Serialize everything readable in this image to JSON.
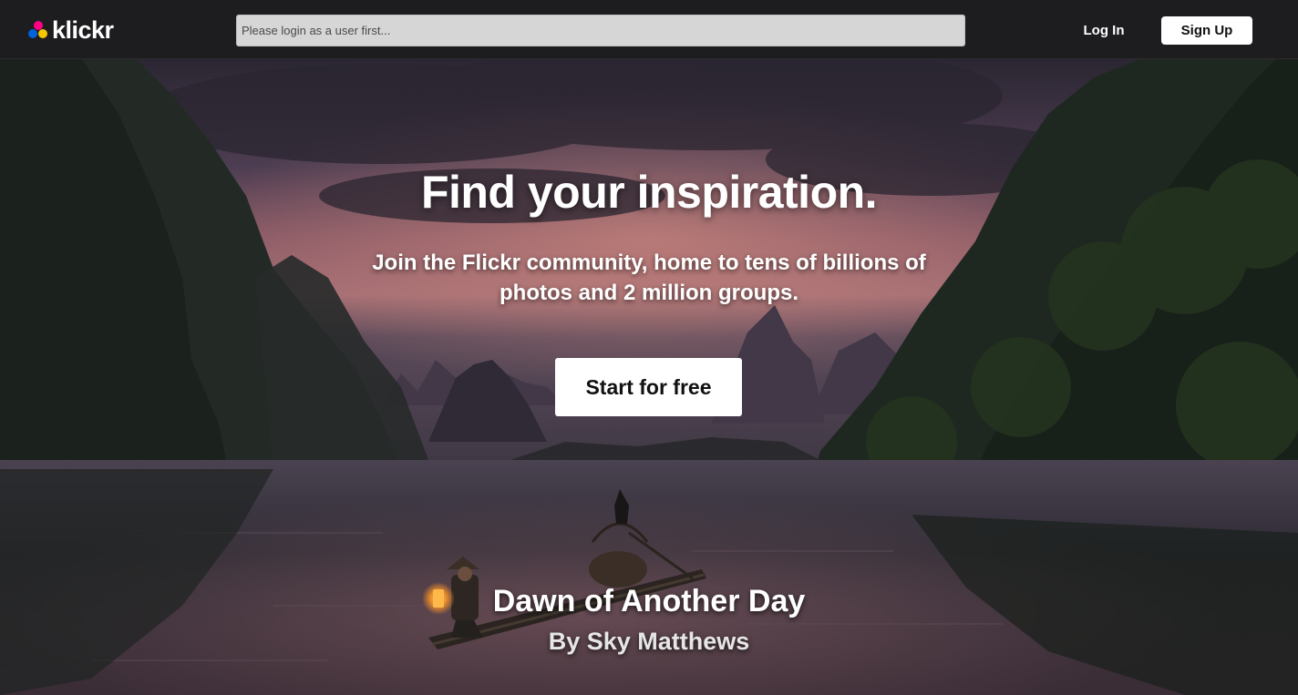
{
  "header": {
    "logo_text": "klickr",
    "search": {
      "placeholder": "Please login as a user first...",
      "value": ""
    },
    "login_label": "Log In",
    "signup_label": "Sign Up"
  },
  "hero": {
    "title": "Find your inspiration.",
    "subtitle": "Join the Flickr community, home to tens of billions of photos and 2 million groups.",
    "cta_label": "Start for free",
    "photo_title": "Dawn of Another Day",
    "photo_author": "By Sky Matthews"
  },
  "colors": {
    "topbar_bg": "#1d1d20",
    "logo_pink": "#ff0084",
    "logo_blue": "#0063dc",
    "logo_yellow": "#f7c600",
    "search_bg": "#d6d6d6",
    "button_bg": "#ffffff"
  },
  "icons": [
    "logo-dots-icon",
    "lantern-icon",
    "cormorant-bird-icon"
  ]
}
